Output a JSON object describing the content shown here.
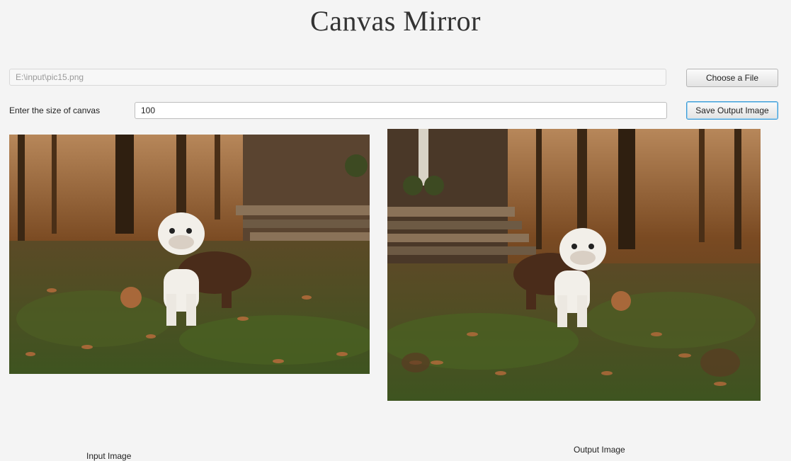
{
  "app": {
    "title": "Canvas Mirror"
  },
  "file": {
    "path": "E:\\input\\pic15.png",
    "choose_button": "Choose a File"
  },
  "canvas_size": {
    "label": "Enter the size of canvas",
    "value": "100"
  },
  "save_button": "Save Output Image",
  "input_image": {
    "caption": "Input Image",
    "description": "photo of a bulldog standing on autumn leaves in a forest"
  },
  "output_image": {
    "caption": "Output Image",
    "description": "mirrored/kaleidoscope version of the input photo"
  },
  "colors": {
    "background": "#f4f4f4",
    "foliage": "#7a4a22",
    "grass": "#4d5e24",
    "focus_border": "#3c9bd6"
  }
}
